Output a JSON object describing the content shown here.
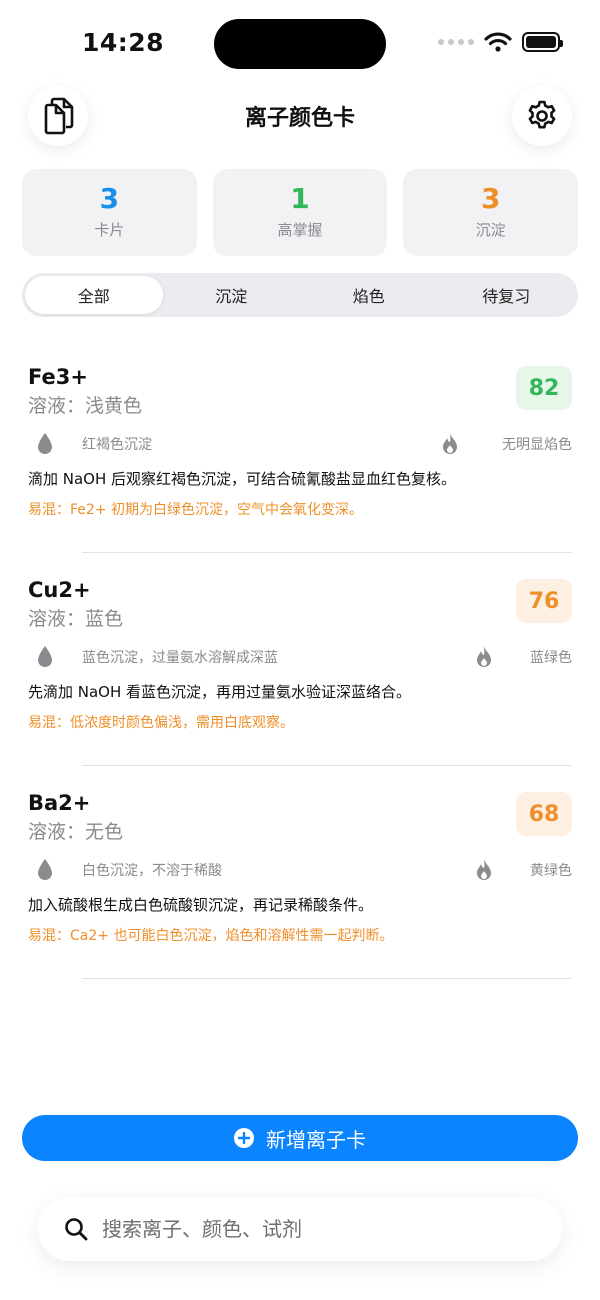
{
  "status_bar": {
    "time": "14:28"
  },
  "header": {
    "title": "离子颜色卡"
  },
  "stats": [
    {
      "value": "3",
      "label": "卡片",
      "color": "#1a8fe8"
    },
    {
      "value": "1",
      "label": "高掌握",
      "color": "#32b75a"
    },
    {
      "value": "3",
      "label": "沉淀",
      "color": "#ef8f2a"
    }
  ],
  "tabs": [
    {
      "label": "全部",
      "active": true
    },
    {
      "label": "沉淀",
      "active": false
    },
    {
      "label": "焰色",
      "active": false
    },
    {
      "label": "待复习",
      "active": false
    }
  ],
  "cards": [
    {
      "ion": "Fe3+",
      "solution": "溶液：浅黄色",
      "score": "82",
      "score_color": "#32b75a",
      "score_bg": "#e6f7ea",
      "precipitate": "红褐色沉淀",
      "flame": "无明显焰色",
      "description": "滴加 NaOH 后观察红褐色沉淀，可结合硫氰酸盐显血红色复核。",
      "tip": "易混：Fe2+ 初期为白绿色沉淀，空气中会氧化变深。"
    },
    {
      "ion": "Cu2+",
      "solution": "溶液：蓝色",
      "score": "76",
      "score_color": "#ef8f2a",
      "score_bg": "#fdf0e3",
      "precipitate": "蓝色沉淀，过量氨水溶解成深蓝",
      "flame": "蓝绿色",
      "description": "先滴加 NaOH 看蓝色沉淀，再用过量氨水验证深蓝络合。",
      "tip": "易混：低浓度时颜色偏浅，需用白底观察。"
    },
    {
      "ion": "Ba2+",
      "solution": "溶液：无色",
      "score": "68",
      "score_color": "#ef8f2a",
      "score_bg": "#fdf0e3",
      "precipitate": "白色沉淀，不溶于稀酸",
      "flame": "黄绿色",
      "description": "加入硫酸根生成白色硫酸钡沉淀，再记录稀酸条件。",
      "tip": "易混：Ca2+ 也可能白色沉淀，焰色和溶解性需一起判断。"
    }
  ],
  "add_button": {
    "label": "新增离子卡"
  },
  "search": {
    "placeholder": "搜索离子、颜色、试剂",
    "value": ""
  },
  "icons": {
    "left_button": "document-copy-icon",
    "right_button": "gear-icon",
    "precipitate": "drop-icon",
    "flame": "flame-icon",
    "add": "plus-circle-icon",
    "search": "search-icon"
  }
}
